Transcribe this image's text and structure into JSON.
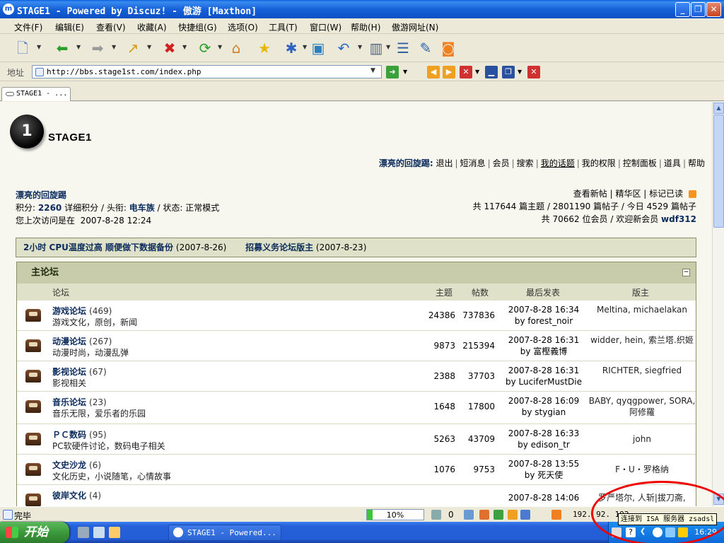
{
  "window": {
    "title": "STAGE1 - Powered by Discuz! - 傲游 [Maxthon]",
    "minimize": "_",
    "maximize": "❐",
    "close": "✕"
  },
  "menu": [
    "文件(F)",
    "编辑(E)",
    "查看(V)",
    "收藏(A)",
    "快捷组(G)",
    "选项(O)",
    "工具(T)",
    "窗口(W)",
    "帮助(H)",
    "傲游网址(N)"
  ],
  "address": {
    "label": "地址",
    "url": "http://bbs.stage1st.com/index.php"
  },
  "tab": {
    "label": "STAGE1 - ..."
  },
  "site": {
    "logo_glyph": "1",
    "name": "STAGE1"
  },
  "topnav": {
    "user": "漂亮的回旋踢:",
    "links": [
      "退出",
      "短消息",
      "会员",
      "搜索",
      "我的话题",
      "我的权限",
      "控制面板",
      "道具",
      "帮助"
    ]
  },
  "userinfo": {
    "name": "漂亮的回旋踢",
    "points_label": "积分:",
    "points": "2260",
    "detail_link": "详细积分",
    "rank_label": "头衔:",
    "rank": "电车族",
    "status_label": "状态:",
    "status": "正常模式",
    "last_visit_label": "您上次访问是在",
    "last_visit": "2007-8-28 12:24"
  },
  "siteinfo": {
    "links": [
      "查看新帖",
      "精华区",
      "标记已读"
    ],
    "stats_line": [
      "共",
      "117644",
      "篇主题",
      "2801190",
      "篇帖子",
      "今日",
      "4529",
      "篇帖子"
    ],
    "members_line": [
      "共",
      "70662",
      "位会员",
      "欢迎新会员",
      "wdf312"
    ]
  },
  "announcements": [
    {
      "text": "2小时  CPU温度过高  顺便做下数据备份",
      "date": "(2007-8-26)"
    },
    {
      "text": "招募义务论坛版主",
      "date": "(2007-8-23)"
    }
  ],
  "forum_section": {
    "title": "主论坛",
    "collapse": "−",
    "columns": {
      "forum": "论坛",
      "topics": "主题",
      "posts": "帖数",
      "last": "最后发表",
      "mods": "版主"
    },
    "rows": [
      {
        "name": "游戏论坛",
        "count": "(469)",
        "desc": "游戏文化，原创，新闻",
        "topics": "24386",
        "posts": "737836",
        "last_time": "2007-8-28 16:34",
        "last_by": "by forest_noir",
        "mods": "Meltina, michaelakan"
      },
      {
        "name": "动漫论坛",
        "count": "(267)",
        "desc": "动漫时尚，动漫乱弹",
        "topics": "9873",
        "posts": "215394",
        "last_time": "2007-8-28 16:31",
        "last_by": "by 富樫義博",
        "mods": "widder, hein, 索兰塔.织姬"
      },
      {
        "name": "影视论坛",
        "count": "(67)",
        "desc": "影视相关",
        "topics": "2388",
        "posts": "37703",
        "last_time": "2007-8-28 16:31",
        "last_by": "by LuciferMustDie",
        "mods": "RICHTER, siegfried"
      },
      {
        "name": "音乐论坛",
        "count": "(23)",
        "desc": "音乐无限，爱乐者的乐园",
        "topics": "1648",
        "posts": "17800",
        "last_time": "2007-8-28 16:09",
        "last_by": "by stygian",
        "mods": "BABY, qyqgpower, SORA, 阿修羅"
      },
      {
        "name": "ＰＣ数码",
        "count": "(95)",
        "desc": "PC软硬件讨论，数码电子相关",
        "topics": "5263",
        "posts": "43709",
        "last_time": "2007-8-28 16:33",
        "last_by": "by edison_tr",
        "mods": "john"
      },
      {
        "name": "文史沙龙",
        "count": "(6)",
        "desc": "文化历史，小说随笔，心情故事",
        "topics": "1076",
        "posts": "9753",
        "last_time": "2007-8-28 13:55",
        "last_by": "by 死天使",
        "mods": "F・U・罗格纳"
      },
      {
        "name": "彼岸文化",
        "count": "(4)",
        "desc": "",
        "topics": "",
        "posts": "",
        "last_time": "2007-8-28 14:06",
        "last_by": "",
        "mods": "罗严塔尔, 人斩|拔刀斋,"
      }
    ]
  },
  "statusbar": {
    "text": "完毕",
    "progress_percent": 10,
    "progress_label": "10%",
    "count": "0",
    "ip": "192.  92. 192."
  },
  "taskbar": {
    "start": "开始",
    "task": "STAGE1 - Powered...",
    "clock": "16:29"
  },
  "tooltip": "连接到 ISA 服务器 zsadsl"
}
